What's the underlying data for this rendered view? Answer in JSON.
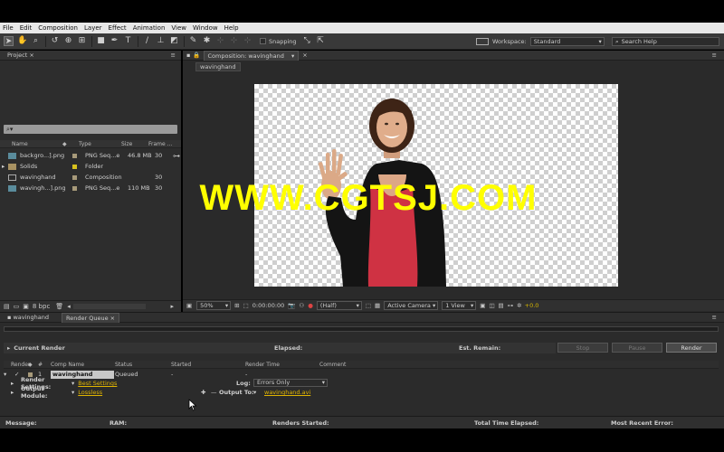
{
  "menu": [
    "File",
    "Edit",
    "Composition",
    "Layer",
    "Effect",
    "Animation",
    "View",
    "Window",
    "Help"
  ],
  "toolbar": {
    "snapping_label": "Snapping",
    "workspace_label": "Workspace:",
    "workspace_value": "Standard",
    "search_placeholder": "Search Help"
  },
  "project": {
    "tab_label": "Project",
    "columns": {
      "name": "Name",
      "type": "Type",
      "size": "Size",
      "frame": "Frame ..."
    },
    "items": [
      {
        "name": "backgro...].png",
        "type": "PNG Seq...e",
        "size": "46.8 MB",
        "frame": "30",
        "icon": "image-sequence-icon",
        "color": "#a79a7a"
      },
      {
        "name": "Solids",
        "type": "Folder",
        "size": "",
        "frame": "",
        "icon": "folder-icon",
        "color": "#d8c21e"
      },
      {
        "name": "wavinghand",
        "type": "Composition",
        "size": "",
        "frame": "30",
        "icon": "composition-icon",
        "color": "#a79a7a"
      },
      {
        "name": "wavingh...].png",
        "type": "PNG Seq...e",
        "size": "110 MB",
        "frame": "30",
        "icon": "image-sequence-icon",
        "color": "#a79a7a"
      }
    ],
    "bpc": "8 bpc"
  },
  "composition": {
    "tab_label": "Composition: wavinghand",
    "sub_tab": "wavinghand",
    "zoom": "50%",
    "timecode": "0:00:00:00",
    "resolution": "(Half)",
    "camera": "Active Camera",
    "views": "1 View",
    "exposure": "+0.0"
  },
  "watermark": "WWW.CGTSJ.COM",
  "bottom": {
    "tabs": [
      "wavinghand",
      "Render Queue"
    ],
    "current_render": "Current Render",
    "elapsed": "Elapsed:",
    "est_remain": "Est. Remain:",
    "stop": "Stop",
    "pause": "Pause",
    "render": "Render",
    "columns": {
      "render": "Render",
      "num": "#",
      "comp": "Comp Name",
      "status": "Status",
      "started": "Started",
      "render_time": "Render Time",
      "comment": "Comment"
    },
    "item": {
      "num": "1",
      "comp": "wavinghand",
      "status": "Queued",
      "started": "-",
      "render_time": "-"
    },
    "render_settings_label": "Render Settings:",
    "render_settings_value": "Best Settings",
    "log_label": "Log:",
    "log_value": "Errors Only",
    "output_module_label": "Output Module:",
    "output_module_value": "Lossless",
    "output_to_label": "Output To:",
    "output_to_value": "wavinghand.avi"
  },
  "footer": {
    "message": "Message:",
    "ram": "RAM:",
    "renders_started": "Renders Started:",
    "total_elapsed": "Total Time Elapsed:",
    "recent_error": "Most Recent Error:"
  }
}
